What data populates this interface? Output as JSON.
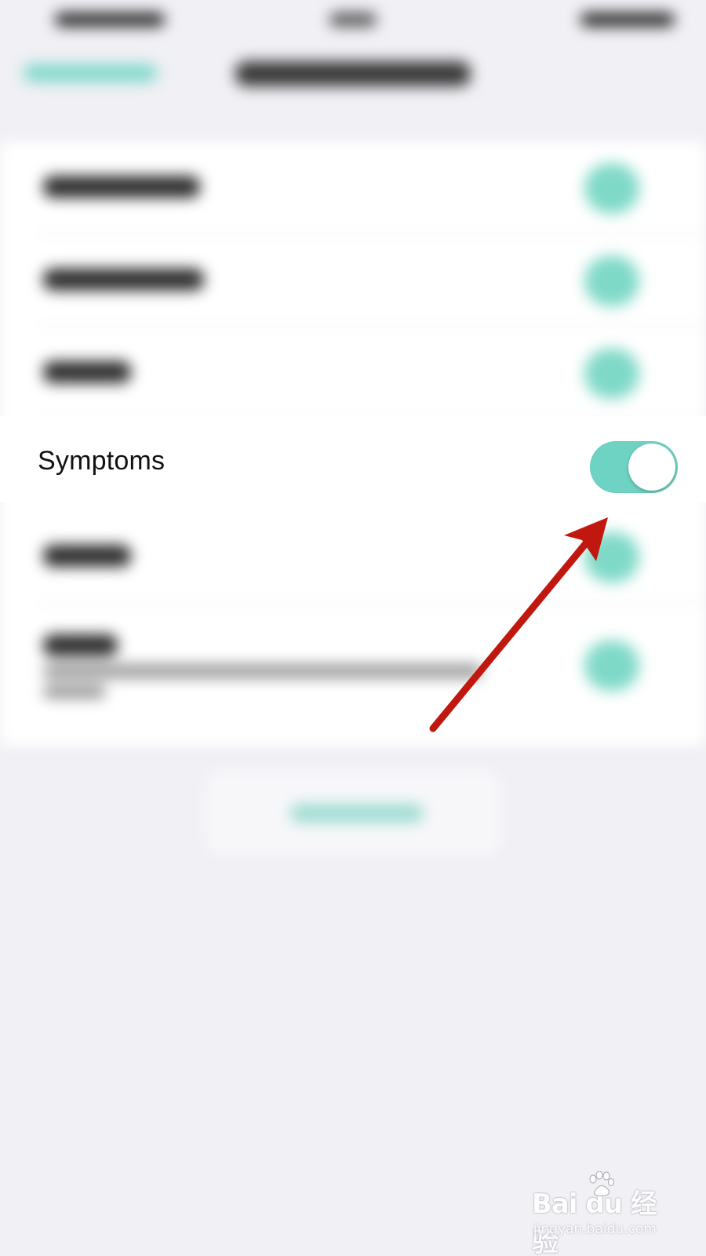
{
  "settings": {
    "focused_row": {
      "label": "Symptoms",
      "toggle_on": true
    }
  },
  "watermark": {
    "brand": "Bai du 经验",
    "url": "jingyan.baidu.com"
  },
  "colors": {
    "accent": "#6ed3c3",
    "annotation_arrow": "#c0180e",
    "background": "#f0f0f5",
    "card": "#ffffff"
  },
  "icons": {
    "annotation": "red-arrow-icon",
    "watermark": "paw-print-icon"
  }
}
